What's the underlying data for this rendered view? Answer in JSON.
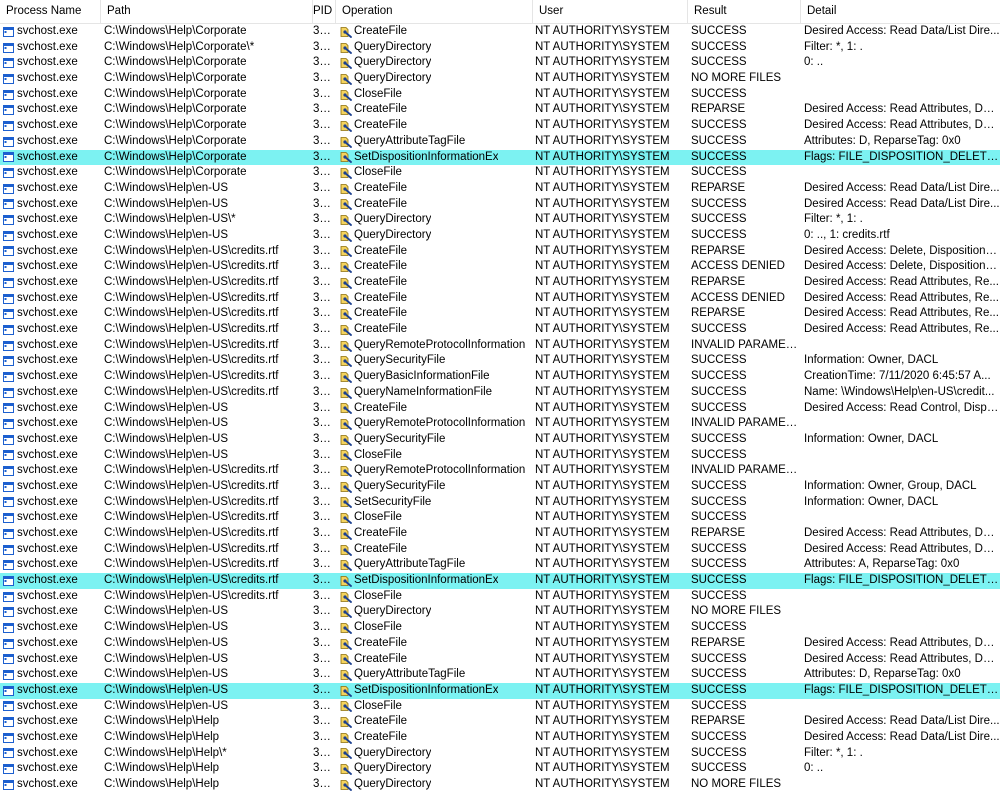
{
  "columns": {
    "process": "Process Name",
    "path": "Path",
    "pid": "PID",
    "operation": "Operation",
    "user": "User",
    "result": "Result",
    "detail": "Detail"
  },
  "icons": {
    "process": "process-window-icon",
    "operation": "file-system-operation-icon"
  },
  "colors": {
    "selected_row": "#7cf2f2",
    "process_icon": "#1c5fcf",
    "operation_icon": "#c8a016"
  },
  "rows": [
    {
      "proc": "svchost.exe",
      "path": "C:\\Windows\\Help\\Corporate",
      "pid": "3184",
      "op": "CreateFile",
      "user": "NT AUTHORITY\\SYSTEM",
      "result": "SUCCESS",
      "detail": "Desired Access: Read Data/List Dire...",
      "sel": false
    },
    {
      "proc": "svchost.exe",
      "path": "C:\\Windows\\Help\\Corporate\\*",
      "pid": "3184",
      "op": "QueryDirectory",
      "user": "NT AUTHORITY\\SYSTEM",
      "result": "SUCCESS",
      "detail": "Filter: *, 1: .",
      "sel": false
    },
    {
      "proc": "svchost.exe",
      "path": "C:\\Windows\\Help\\Corporate",
      "pid": "3184",
      "op": "QueryDirectory",
      "user": "NT AUTHORITY\\SYSTEM",
      "result": "SUCCESS",
      "detail": "0: ..",
      "sel": false
    },
    {
      "proc": "svchost.exe",
      "path": "C:\\Windows\\Help\\Corporate",
      "pid": "3184",
      "op": "QueryDirectory",
      "user": "NT AUTHORITY\\SYSTEM",
      "result": "NO MORE FILES",
      "detail": "",
      "sel": false
    },
    {
      "proc": "svchost.exe",
      "path": "C:\\Windows\\Help\\Corporate",
      "pid": "3184",
      "op": "CloseFile",
      "user": "NT AUTHORITY\\SYSTEM",
      "result": "SUCCESS",
      "detail": "",
      "sel": false
    },
    {
      "proc": "svchost.exe",
      "path": "C:\\Windows\\Help\\Corporate",
      "pid": "3184",
      "op": "CreateFile",
      "user": "NT AUTHORITY\\SYSTEM",
      "result": "REPARSE",
      "detail": "Desired Access: Read Attributes, Del...",
      "sel": false
    },
    {
      "proc": "svchost.exe",
      "path": "C:\\Windows\\Help\\Corporate",
      "pid": "3184",
      "op": "CreateFile",
      "user": "NT AUTHORITY\\SYSTEM",
      "result": "SUCCESS",
      "detail": "Desired Access: Read Attributes, Del...",
      "sel": false
    },
    {
      "proc": "svchost.exe",
      "path": "C:\\Windows\\Help\\Corporate",
      "pid": "3184",
      "op": "QueryAttributeTagFile",
      "user": "NT AUTHORITY\\SYSTEM",
      "result": "SUCCESS",
      "detail": "Attributes: D, ReparseTag: 0x0",
      "sel": false
    },
    {
      "proc": "svchost.exe",
      "path": "C:\\Windows\\Help\\Corporate",
      "pid": "3184",
      "op": "SetDispositionInformationEx",
      "user": "NT AUTHORITY\\SYSTEM",
      "result": "SUCCESS",
      "detail": "Flags: FILE_DISPOSITION_DELETE...",
      "sel": true
    },
    {
      "proc": "svchost.exe",
      "path": "C:\\Windows\\Help\\Corporate",
      "pid": "3184",
      "op": "CloseFile",
      "user": "NT AUTHORITY\\SYSTEM",
      "result": "SUCCESS",
      "detail": "",
      "sel": false
    },
    {
      "proc": "svchost.exe",
      "path": "C:\\Windows\\Help\\en-US",
      "pid": "3184",
      "op": "CreateFile",
      "user": "NT AUTHORITY\\SYSTEM",
      "result": "REPARSE",
      "detail": "Desired Access: Read Data/List Dire...",
      "sel": false
    },
    {
      "proc": "svchost.exe",
      "path": "C:\\Windows\\Help\\en-US",
      "pid": "3184",
      "op": "CreateFile",
      "user": "NT AUTHORITY\\SYSTEM",
      "result": "SUCCESS",
      "detail": "Desired Access: Read Data/List Dire...",
      "sel": false
    },
    {
      "proc": "svchost.exe",
      "path": "C:\\Windows\\Help\\en-US\\*",
      "pid": "3184",
      "op": "QueryDirectory",
      "user": "NT AUTHORITY\\SYSTEM",
      "result": "SUCCESS",
      "detail": "Filter: *, 1: .",
      "sel": false
    },
    {
      "proc": "svchost.exe",
      "path": "C:\\Windows\\Help\\en-US",
      "pid": "3184",
      "op": "QueryDirectory",
      "user": "NT AUTHORITY\\SYSTEM",
      "result": "SUCCESS",
      "detail": "0: .., 1: credits.rtf",
      "sel": false
    },
    {
      "proc": "svchost.exe",
      "path": "C:\\Windows\\Help\\en-US\\credits.rtf",
      "pid": "3184",
      "op": "CreateFile",
      "user": "NT AUTHORITY\\SYSTEM",
      "result": "REPARSE",
      "detail": "Desired Access: Delete, Disposition: ...",
      "sel": false
    },
    {
      "proc": "svchost.exe",
      "path": "C:\\Windows\\Help\\en-US\\credits.rtf",
      "pid": "3184",
      "op": "CreateFile",
      "user": "NT AUTHORITY\\SYSTEM",
      "result": "ACCESS DENIED",
      "detail": "Desired Access: Delete, Disposition: ...",
      "sel": false
    },
    {
      "proc": "svchost.exe",
      "path": "C:\\Windows\\Help\\en-US\\credits.rtf",
      "pid": "3184",
      "op": "CreateFile",
      "user": "NT AUTHORITY\\SYSTEM",
      "result": "REPARSE",
      "detail": "Desired Access: Read Attributes, Re...",
      "sel": false
    },
    {
      "proc": "svchost.exe",
      "path": "C:\\Windows\\Help\\en-US\\credits.rtf",
      "pid": "3184",
      "op": "CreateFile",
      "user": "NT AUTHORITY\\SYSTEM",
      "result": "ACCESS DENIED",
      "detail": "Desired Access: Read Attributes, Re...",
      "sel": false
    },
    {
      "proc": "svchost.exe",
      "path": "C:\\Windows\\Help\\en-US\\credits.rtf",
      "pid": "3184",
      "op": "CreateFile",
      "user": "NT AUTHORITY\\SYSTEM",
      "result": "REPARSE",
      "detail": "Desired Access: Read Attributes, Re...",
      "sel": false
    },
    {
      "proc": "svchost.exe",
      "path": "C:\\Windows\\Help\\en-US\\credits.rtf",
      "pid": "3184",
      "op": "CreateFile",
      "user": "NT AUTHORITY\\SYSTEM",
      "result": "SUCCESS",
      "detail": "Desired Access: Read Attributes, Re...",
      "sel": false
    },
    {
      "proc": "svchost.exe",
      "path": "C:\\Windows\\Help\\en-US\\credits.rtf",
      "pid": "3184",
      "op": "QueryRemoteProtocolInformation",
      "user": "NT AUTHORITY\\SYSTEM",
      "result": "INVALID PARAMET...",
      "detail": "",
      "sel": false
    },
    {
      "proc": "svchost.exe",
      "path": "C:\\Windows\\Help\\en-US\\credits.rtf",
      "pid": "3184",
      "op": "QuerySecurityFile",
      "user": "NT AUTHORITY\\SYSTEM",
      "result": "SUCCESS",
      "detail": "Information: Owner, DACL",
      "sel": false
    },
    {
      "proc": "svchost.exe",
      "path": "C:\\Windows\\Help\\en-US\\credits.rtf",
      "pid": "3184",
      "op": "QueryBasicInformationFile",
      "user": "NT AUTHORITY\\SYSTEM",
      "result": "SUCCESS",
      "detail": "CreationTime: 7/11/2020 6:45:57 A...",
      "sel": false
    },
    {
      "proc": "svchost.exe",
      "path": "C:\\Windows\\Help\\en-US\\credits.rtf",
      "pid": "3184",
      "op": "QueryNameInformationFile",
      "user": "NT AUTHORITY\\SYSTEM",
      "result": "SUCCESS",
      "detail": "Name: \\Windows\\Help\\en-US\\credit...",
      "sel": false
    },
    {
      "proc": "svchost.exe",
      "path": "C:\\Windows\\Help\\en-US",
      "pid": "3184",
      "op": "CreateFile",
      "user": "NT AUTHORITY\\SYSTEM",
      "result": "SUCCESS",
      "detail": "Desired Access: Read Control, Dispo...",
      "sel": false
    },
    {
      "proc": "svchost.exe",
      "path": "C:\\Windows\\Help\\en-US",
      "pid": "3184",
      "op": "QueryRemoteProtocolInformation",
      "user": "NT AUTHORITY\\SYSTEM",
      "result": "INVALID PARAMET...",
      "detail": "",
      "sel": false
    },
    {
      "proc": "svchost.exe",
      "path": "C:\\Windows\\Help\\en-US",
      "pid": "3184",
      "op": "QuerySecurityFile",
      "user": "NT AUTHORITY\\SYSTEM",
      "result": "SUCCESS",
      "detail": "Information: Owner, DACL",
      "sel": false
    },
    {
      "proc": "svchost.exe",
      "path": "C:\\Windows\\Help\\en-US",
      "pid": "3184",
      "op": "CloseFile",
      "user": "NT AUTHORITY\\SYSTEM",
      "result": "SUCCESS",
      "detail": "",
      "sel": false
    },
    {
      "proc": "svchost.exe",
      "path": "C:\\Windows\\Help\\en-US\\credits.rtf",
      "pid": "3184",
      "op": "QueryRemoteProtocolInformation",
      "user": "NT AUTHORITY\\SYSTEM",
      "result": "INVALID PARAMET...",
      "detail": "",
      "sel": false
    },
    {
      "proc": "svchost.exe",
      "path": "C:\\Windows\\Help\\en-US\\credits.rtf",
      "pid": "3184",
      "op": "QuerySecurityFile",
      "user": "NT AUTHORITY\\SYSTEM",
      "result": "SUCCESS",
      "detail": "Information: Owner, Group, DACL",
      "sel": false
    },
    {
      "proc": "svchost.exe",
      "path": "C:\\Windows\\Help\\en-US\\credits.rtf",
      "pid": "3184",
      "op": "SetSecurityFile",
      "user": "NT AUTHORITY\\SYSTEM",
      "result": "SUCCESS",
      "detail": "Information: Owner, DACL",
      "sel": false
    },
    {
      "proc": "svchost.exe",
      "path": "C:\\Windows\\Help\\en-US\\credits.rtf",
      "pid": "3184",
      "op": "CloseFile",
      "user": "NT AUTHORITY\\SYSTEM",
      "result": "SUCCESS",
      "detail": "",
      "sel": false
    },
    {
      "proc": "svchost.exe",
      "path": "C:\\Windows\\Help\\en-US\\credits.rtf",
      "pid": "3184",
      "op": "CreateFile",
      "user": "NT AUTHORITY\\SYSTEM",
      "result": "REPARSE",
      "detail": "Desired Access: Read Attributes, Del...",
      "sel": false
    },
    {
      "proc": "svchost.exe",
      "path": "C:\\Windows\\Help\\en-US\\credits.rtf",
      "pid": "3184",
      "op": "CreateFile",
      "user": "NT AUTHORITY\\SYSTEM",
      "result": "SUCCESS",
      "detail": "Desired Access: Read Attributes, Del...",
      "sel": false
    },
    {
      "proc": "svchost.exe",
      "path": "C:\\Windows\\Help\\en-US\\credits.rtf",
      "pid": "3184",
      "op": "QueryAttributeTagFile",
      "user": "NT AUTHORITY\\SYSTEM",
      "result": "SUCCESS",
      "detail": "Attributes: A, ReparseTag: 0x0",
      "sel": false
    },
    {
      "proc": "svchost.exe",
      "path": "C:\\Windows\\Help\\en-US\\credits.rtf",
      "pid": "3184",
      "op": "SetDispositionInformationEx",
      "user": "NT AUTHORITY\\SYSTEM",
      "result": "SUCCESS",
      "detail": "Flags: FILE_DISPOSITION_DELETE...",
      "sel": true
    },
    {
      "proc": "svchost.exe",
      "path": "C:\\Windows\\Help\\en-US\\credits.rtf",
      "pid": "3184",
      "op": "CloseFile",
      "user": "NT AUTHORITY\\SYSTEM",
      "result": "SUCCESS",
      "detail": "",
      "sel": false
    },
    {
      "proc": "svchost.exe",
      "path": "C:\\Windows\\Help\\en-US",
      "pid": "3184",
      "op": "QueryDirectory",
      "user": "NT AUTHORITY\\SYSTEM",
      "result": "NO MORE FILES",
      "detail": "",
      "sel": false
    },
    {
      "proc": "svchost.exe",
      "path": "C:\\Windows\\Help\\en-US",
      "pid": "3184",
      "op": "CloseFile",
      "user": "NT AUTHORITY\\SYSTEM",
      "result": "SUCCESS",
      "detail": "",
      "sel": false
    },
    {
      "proc": "svchost.exe",
      "path": "C:\\Windows\\Help\\en-US",
      "pid": "3184",
      "op": "CreateFile",
      "user": "NT AUTHORITY\\SYSTEM",
      "result": "REPARSE",
      "detail": "Desired Access: Read Attributes, Del...",
      "sel": false
    },
    {
      "proc": "svchost.exe",
      "path": "C:\\Windows\\Help\\en-US",
      "pid": "3184",
      "op": "CreateFile",
      "user": "NT AUTHORITY\\SYSTEM",
      "result": "SUCCESS",
      "detail": "Desired Access: Read Attributes, Del...",
      "sel": false
    },
    {
      "proc": "svchost.exe",
      "path": "C:\\Windows\\Help\\en-US",
      "pid": "3184",
      "op": "QueryAttributeTagFile",
      "user": "NT AUTHORITY\\SYSTEM",
      "result": "SUCCESS",
      "detail": "Attributes: D, ReparseTag: 0x0",
      "sel": false
    },
    {
      "proc": "svchost.exe",
      "path": "C:\\Windows\\Help\\en-US",
      "pid": "3184",
      "op": "SetDispositionInformationEx",
      "user": "NT AUTHORITY\\SYSTEM",
      "result": "SUCCESS",
      "detail": "Flags: FILE_DISPOSITION_DELETE...",
      "sel": true
    },
    {
      "proc": "svchost.exe",
      "path": "C:\\Windows\\Help\\en-US",
      "pid": "3184",
      "op": "CloseFile",
      "user": "NT AUTHORITY\\SYSTEM",
      "result": "SUCCESS",
      "detail": "",
      "sel": false
    },
    {
      "proc": "svchost.exe",
      "path": "C:\\Windows\\Help\\Help",
      "pid": "3184",
      "op": "CreateFile",
      "user": "NT AUTHORITY\\SYSTEM",
      "result": "REPARSE",
      "detail": "Desired Access: Read Data/List Dire...",
      "sel": false
    },
    {
      "proc": "svchost.exe",
      "path": "C:\\Windows\\Help\\Help",
      "pid": "3184",
      "op": "CreateFile",
      "user": "NT AUTHORITY\\SYSTEM",
      "result": "SUCCESS",
      "detail": "Desired Access: Read Data/List Dire...",
      "sel": false
    },
    {
      "proc": "svchost.exe",
      "path": "C:\\Windows\\Help\\Help\\*",
      "pid": "3184",
      "op": "QueryDirectory",
      "user": "NT AUTHORITY\\SYSTEM",
      "result": "SUCCESS",
      "detail": "Filter: *, 1: .",
      "sel": false
    },
    {
      "proc": "svchost.exe",
      "path": "C:\\Windows\\Help\\Help",
      "pid": "3184",
      "op": "QueryDirectory",
      "user": "NT AUTHORITY\\SYSTEM",
      "result": "SUCCESS",
      "detail": "0: ..",
      "sel": false
    },
    {
      "proc": "svchost.exe",
      "path": "C:\\Windows\\Help\\Help",
      "pid": "3184",
      "op": "QueryDirectory",
      "user": "NT AUTHORITY\\SYSTEM",
      "result": "NO MORE FILES",
      "detail": "",
      "sel": false
    }
  ]
}
